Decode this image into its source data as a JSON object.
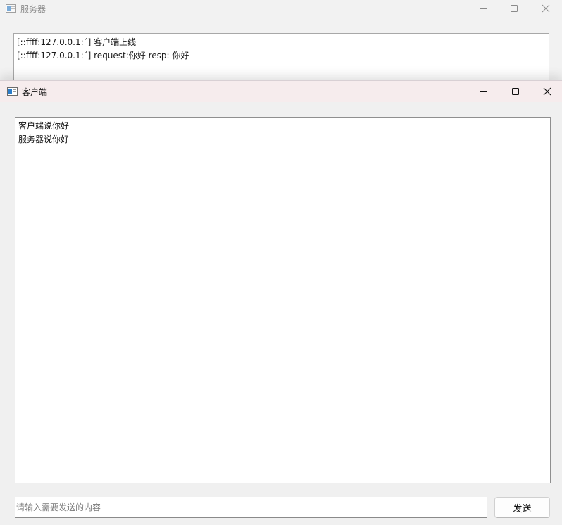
{
  "server_window": {
    "title": "服务器",
    "icon": "app-window-icon",
    "controls": {
      "minimize": "minimize-icon",
      "maximize": "maximize-icon",
      "close": "close-icon"
    },
    "log_lines": [
      "[::ffff:127.0.0.1:´] 客户端上线",
      "[::ffff:127.0.0.1:´] request:你好 resp: 你好"
    ]
  },
  "client_window": {
    "title": "客户端",
    "icon": "app-window-icon",
    "controls": {
      "minimize": "minimize-icon",
      "maximize": "maximize-icon",
      "close": "close-icon"
    },
    "messages": [
      "客户端说你好",
      "服务器说你好"
    ],
    "input": {
      "value": "",
      "placeholder": "请输入需要发送的内容"
    },
    "send_label": "发送"
  },
  "colors": {
    "active_titlebar": "#f6eced",
    "window_background": "#f0f0f0",
    "text_area_background": "#ffffff"
  }
}
